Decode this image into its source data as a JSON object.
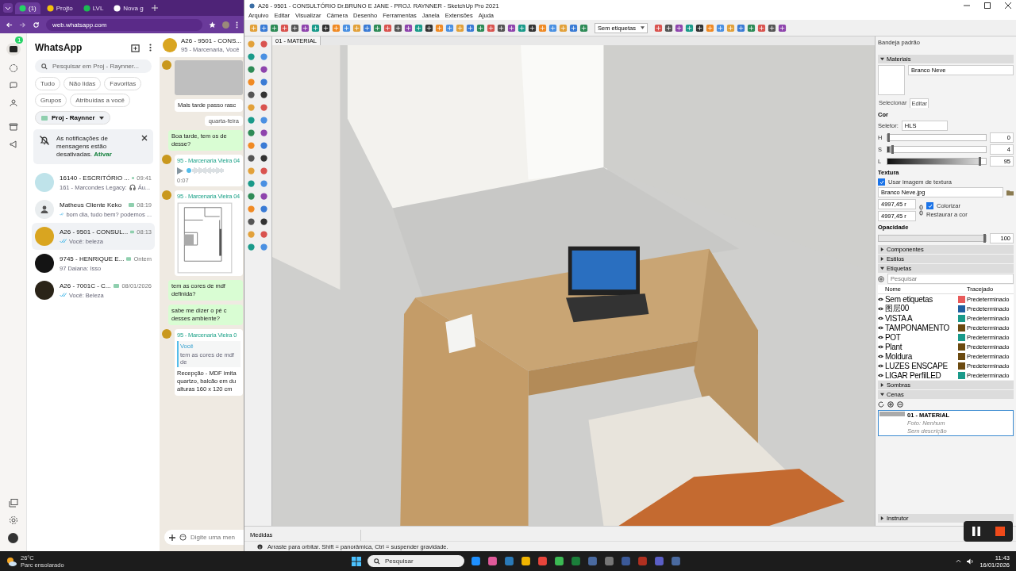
{
  "browser": {
    "tabs": [
      {
        "label": "(1)",
        "selected": true,
        "kind": "chat"
      },
      {
        "label": "Projto",
        "selected": false,
        "kind": "note"
      },
      {
        "label": "LVL",
        "selected": false,
        "kind": "music"
      },
      {
        "label": "Nova g",
        "selected": false,
        "kind": "globe"
      }
    ],
    "url": "web.whatsapp.com"
  },
  "whatsapp": {
    "unread_badge": "1",
    "title": "WhatsApp",
    "search": {
      "placeholder": "Pesquisar em Proj - Raynner..."
    },
    "filters": [
      {
        "label": "Tudo",
        "selected": false
      },
      {
        "label": "Não lidas",
        "selected": false
      },
      {
        "label": "Favoritas",
        "selected": false
      },
      {
        "label": "Grupos",
        "selected": false
      },
      {
        "label": "Atribuídas a você",
        "selected": false
      }
    ],
    "list_filter": "Proj - Raynner",
    "notice": {
      "text": "As notificações de mensagens estão desativadas.",
      "link": "Ativar"
    },
    "chats": [
      {
        "kind": "group",
        "color": "#bfe3ea",
        "name": "16140 - ESCRITÓRIO ...",
        "time": "09:41",
        "ticks": false,
        "preview": "161 - Marcondes Legacy:",
        "attachment": "Áu...",
        "selected": false
      },
      {
        "kind": "person",
        "color": "#e9edef",
        "name": "Matheus Cliente Keko",
        "time": "08:19",
        "ticks": true,
        "preview": "bom dia, tudo bem? podemos ...",
        "selected": false
      },
      {
        "kind": "group",
        "color": "#d9a520",
        "name": "A26 - 9501 - CONSUL...",
        "time": "08:13",
        "ticks": true,
        "preview": "Você: beleza",
        "selected": true
      },
      {
        "kind": "group",
        "color": "#141414",
        "name": "9745 - HENRIQUE E...",
        "time": "Ontem",
        "ticks": false,
        "preview": "97 Daiana: Isso",
        "selected": false
      },
      {
        "kind": "group",
        "color": "#2a2418",
        "name": "A26 - 7001C - C...",
        "time": "08/01/2026",
        "ticks": true,
        "preview": "Você: Beleza",
        "selected": false
      }
    ],
    "chat": {
      "name": "A26 - 9501 - CONS...",
      "members": "95 - Marcenaria, Você",
      "messages": [
        {
          "kind": "photo"
        },
        {
          "kind": "in",
          "text": "Mais tarde passo rasc"
        },
        {
          "kind": "date",
          "text": "quarta-feira"
        },
        {
          "kind": "out",
          "text": "Boa tarde, tem os de desse?"
        },
        {
          "kind": "audio",
          "sender": "95 - Marcenaria Vieira 04",
          "duration": "0:07"
        },
        {
          "kind": "image",
          "sender": "95 - Marcenaria Vieira 04"
        },
        {
          "kind": "out",
          "text": "tem as cores de mdf definida?"
        },
        {
          "kind": "out",
          "text": "sabe me dizer o pé c desses ambiente?"
        },
        {
          "kind": "reply",
          "sender": "95 - Marcenaria Vieira 0",
          "quote_author": "Você",
          "quote": "tem as cores de mdf de",
          "text": "Recepção - MDF imita quartzo, balcão em du alturas 160 x 120 cm"
        }
      ],
      "compose_placeholder": "Digite uma men"
    }
  },
  "sketchup": {
    "title": "A26 - 9501 - CONSULTÓRIO Dr.BRUNO E JANE - PROJ. RAYNNER - SketchUp Pro 2021",
    "menu": [
      "Arquivo",
      "Editar",
      "Visualizar",
      "Câmera",
      "Desenho",
      "Ferramentas",
      "Janela",
      "Extensões",
      "Ajuda"
    ],
    "tag_filter": "Sem etiquetas",
    "scene_tab": "01 - MATERIAL",
    "tray": {
      "title": "Bandeja padrão",
      "materials": {
        "title": "Materiais",
        "expanded": true,
        "name": "Branco Neve",
        "tabs": [
          {
            "label": "Selecionar",
            "selected": false
          },
          {
            "label": "Editar",
            "selected": true
          }
        ],
        "color_heading": "Cor",
        "picker_label": "Seletor:",
        "picker": "HLS",
        "channels": [
          {
            "name": "H",
            "level": 0,
            "value": "0"
          },
          {
            "name": "S",
            "level": 0.04,
            "value": "4"
          },
          {
            "name": "L",
            "level": 0.95,
            "value": "95"
          }
        ],
        "texture_heading": "Textura",
        "use_texture": {
          "label": "Usar imagem de textura",
          "checked": true
        },
        "texture_file": "Branco Neve.jpg",
        "width": "4997,45 r",
        "height": "4997,45 r",
        "colorize": {
          "label": "Colorizar",
          "checked": true
        },
        "reset": "Restaurar a cor",
        "opacity_heading": "Opacidade",
        "opacity": {
          "level": 1,
          "value": "100"
        }
      },
      "panels": [
        {
          "kind": "plain",
          "title": "Componentes",
          "expanded": false
        },
        {
          "kind": "plain",
          "title": "Estilos",
          "expanded": false
        },
        {
          "kind": "tags",
          "title": "Etiquetas",
          "expanded": true,
          "search_placeholder": "Pesquisar",
          "columns": [
            "Nome",
            "Tracejado"
          ],
          "rows": [
            {
              "name": "Sem etiquetas",
              "color": "#e85a5a",
              "dash": "Predeterminado"
            },
            {
              "name": "图层00",
              "color": "#1f5fa0",
              "dash": "Predeterminado"
            },
            {
              "name": "VISTA A",
              "color": "#1a9a8a",
              "dash": "Predeterminado"
            },
            {
              "name": "TAMPONAMENTO",
              "color": "#6b4a10",
              "dash": "Predeterminado"
            },
            {
              "name": "POT",
              "color": "#1a9a8a",
              "dash": "Predeterminado"
            },
            {
              "name": "Plant",
              "color": "#6b4a10",
              "dash": "Predeterminado"
            },
            {
              "name": "Moldura",
              "color": "#6b4a10",
              "dash": "Predeterminado"
            },
            {
              "name": "LUZES ENSCAPE",
              "color": "#6b4a10",
              "dash": "Predeterminado"
            },
            {
              "name": "LIGAR PerfilLED",
              "color": "#1a9a8a",
              "dash": "Predeterminado"
            }
          ]
        },
        {
          "kind": "plain",
          "title": "Sombras",
          "expanded": false
        },
        {
          "kind": "scenes",
          "title": "Cenas",
          "expanded": true,
          "items": [
            {
              "name": "01 - MATERIAL",
              "photo": "Foto: Nenhum",
              "description": "Sem descrição",
              "selected": true
            }
          ]
        },
        {
          "kind": "plain",
          "title": "Instrutor",
          "expanded": false
        }
      ]
    },
    "measurements_label": "Medidas",
    "status": "Arraste para orbitar. Shift = panorâmica, Ctrl = suspender gravidade."
  },
  "taskbar": {
    "weather": {
      "temp": "26°C",
      "text": "Parc ensolarado"
    },
    "search_placeholder": "Pesquisar",
    "time": "11:43",
    "date": "16/01/2026"
  }
}
